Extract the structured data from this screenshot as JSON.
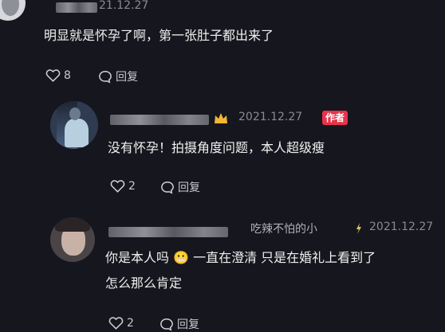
{
  "comments": [
    {
      "date": "21.12.27",
      "text": "明显就是怀孕了啊，第一张肚子都出来了",
      "likes": "8",
      "reply_label": "回复"
    },
    {
      "date": "2021.12.27",
      "badge": "作者",
      "text": "没有怀孕！拍摄角度问题，本人超级瘦",
      "likes": "2",
      "reply_label": "回复"
    },
    {
      "name": "吃辣不怕的小",
      "date": "2021.12.27",
      "text_line1": "你是本人吗 😬 一直在澄清 只是在婚礼上看到了",
      "text_line2": "怎么那么肯定",
      "likes": "2",
      "reply_label": "回复"
    }
  ],
  "colors": {
    "background": "#16161e",
    "author_badge": "#e8334a",
    "muted": "#8a8a92"
  }
}
